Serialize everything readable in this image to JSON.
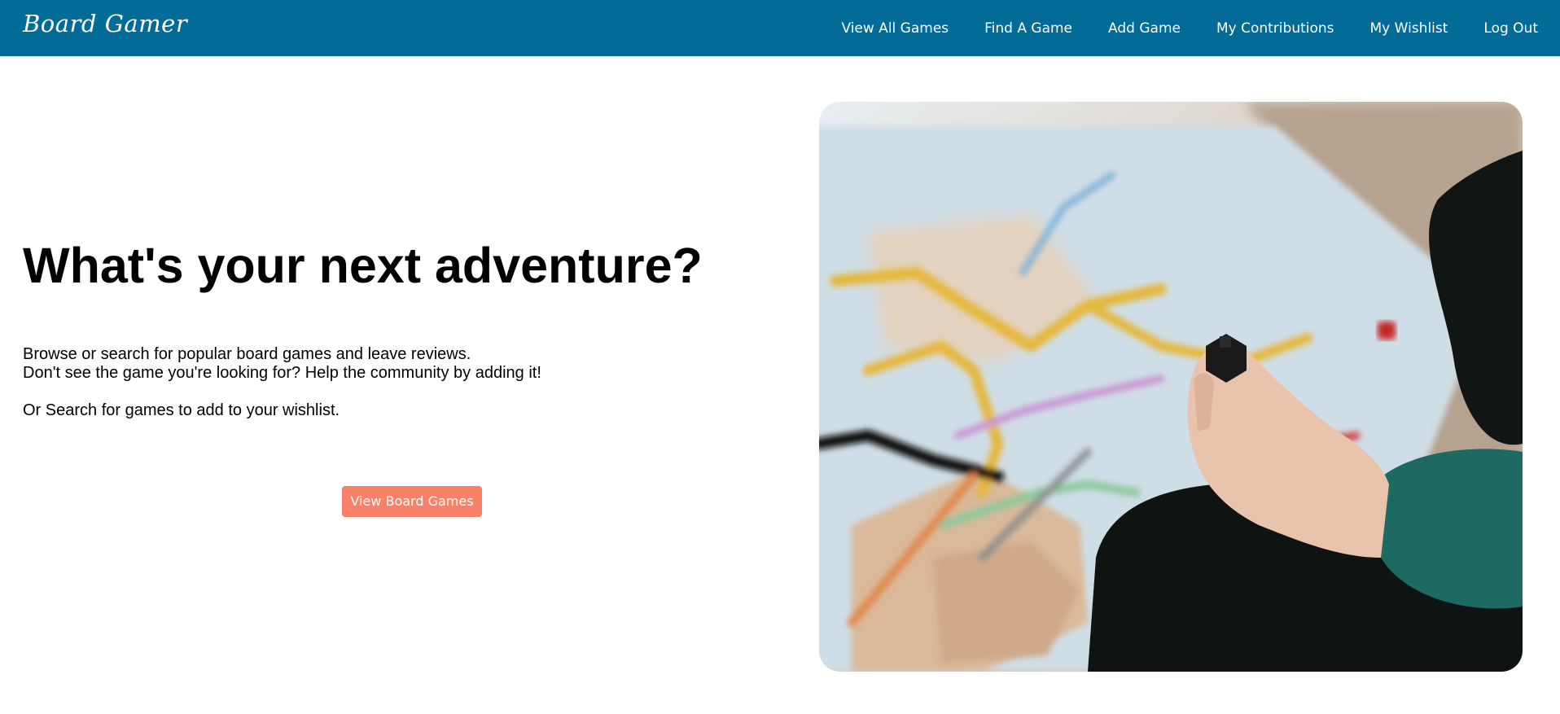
{
  "nav": {
    "brand": "Board Gamer",
    "links": [
      "View All Games",
      "Find A Game",
      "Add Game",
      "My Contributions",
      "My Wishlist",
      "Log Out"
    ]
  },
  "hero": {
    "headline": "What's your next adventure?",
    "lines": [
      "Browse or search for popular board games and leave reviews.",
      "Don't see the game you're looking for? Help the community by adding it!",
      "Or Search for games to add to your wishlist."
    ],
    "cta_label": "View Board Games",
    "image_subject": "hand-holding-game-piece-over-board-map"
  },
  "colors": {
    "nav_bg": "#026b97",
    "cta_bg": "#fa8167"
  }
}
